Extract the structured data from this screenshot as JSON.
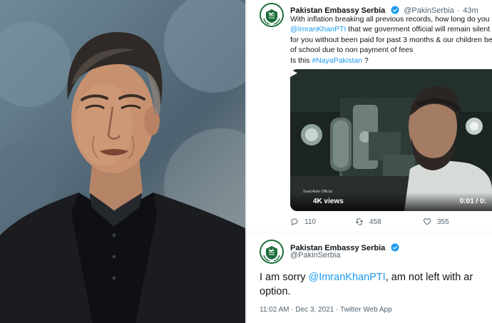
{
  "tweet1": {
    "author_name": "Pakistan Embassy Serbia",
    "handle": "@PakinSerbia",
    "separator": "·",
    "time": "43m",
    "lines": [
      {
        "pre": "With inflation breaking all previous records, how long do you e",
        "link": "",
        "post": ""
      },
      {
        "pre": "",
        "link": "@ImranKhanPTI",
        "post": " that we goverment official will remain silent &"
      },
      {
        "pre": "for you without been paid for past 3 months & our children be",
        "link": "",
        "post": ""
      },
      {
        "pre": "of school due to non payment of fees",
        "link": "",
        "post": ""
      },
      {
        "pre": "Is this ",
        "link": "#NayaPakistan",
        "post": " ?"
      }
    ],
    "video": {
      "views": "4K views",
      "duration": "0:01 / 0:",
      "watermark": "Saad Alam Official"
    },
    "actions": {
      "replies": "110",
      "retweets": "458",
      "likes": "355"
    }
  },
  "tweet2": {
    "author_name": "Pakistan Embassy Serbia",
    "handle": "@PakinSerbia",
    "line1_pre": "I am sorry ",
    "line1_link": "@ImranKhanPTI",
    "line1_post": ", am not left with ar",
    "line2": "option.",
    "timestamp": "11:02 AM · Dec 3, 2021 · Twitter Web App"
  },
  "icons": {
    "verified": "verified-badge-icon",
    "reply": "reply-icon",
    "retweet": "retweet-icon",
    "like": "heart-icon",
    "play": "play-icon",
    "avatar_emblem": "pakistan-emblem-icon"
  },
  "colors": {
    "link": "#1d9bf0",
    "text": "#0f1419",
    "muted": "#536471",
    "verified": "#1d9bf0",
    "emblem_green": "#1b6e3b"
  }
}
